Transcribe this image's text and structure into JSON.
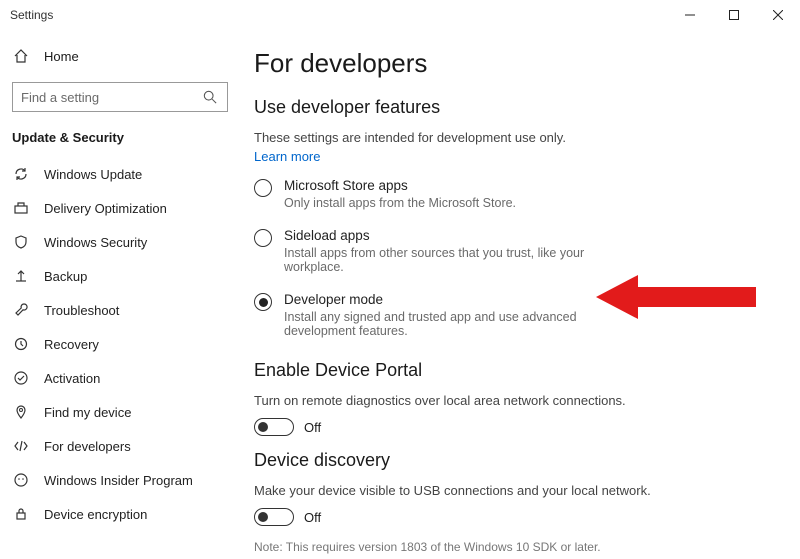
{
  "window": {
    "title": "Settings"
  },
  "sidebar": {
    "home_label": "Home",
    "search_placeholder": "Find a setting",
    "section_title": "Update & Security",
    "items": [
      {
        "label": "Windows Update"
      },
      {
        "label": "Delivery Optimization"
      },
      {
        "label": "Windows Security"
      },
      {
        "label": "Backup"
      },
      {
        "label": "Troubleshoot"
      },
      {
        "label": "Recovery"
      },
      {
        "label": "Activation"
      },
      {
        "label": "Find my device"
      },
      {
        "label": "For developers"
      },
      {
        "label": "Windows Insider Program"
      },
      {
        "label": "Device encryption"
      }
    ]
  },
  "main": {
    "page_title": "For developers",
    "dev_features": {
      "heading": "Use developer features",
      "intro": "These settings are intended for development use only.",
      "learn_more": "Learn more",
      "options": [
        {
          "label": "Microsoft Store apps",
          "desc": "Only install apps from the Microsoft Store.",
          "selected": false
        },
        {
          "label": "Sideload apps",
          "desc": "Install apps from other sources that you trust, like your workplace.",
          "selected": false
        },
        {
          "label": "Developer mode",
          "desc": "Install any signed and trusted app and use advanced development features.",
          "selected": true
        }
      ]
    },
    "device_portal": {
      "heading": "Enable Device Portal",
      "desc": "Turn on remote diagnostics over local area network connections.",
      "toggle_state": "Off"
    },
    "device_discovery": {
      "heading": "Device discovery",
      "desc": "Make your device visible to USB connections and your local network.",
      "toggle_state": "Off",
      "note": "Note: This requires version 1803 of the Windows 10 SDK or later."
    }
  }
}
